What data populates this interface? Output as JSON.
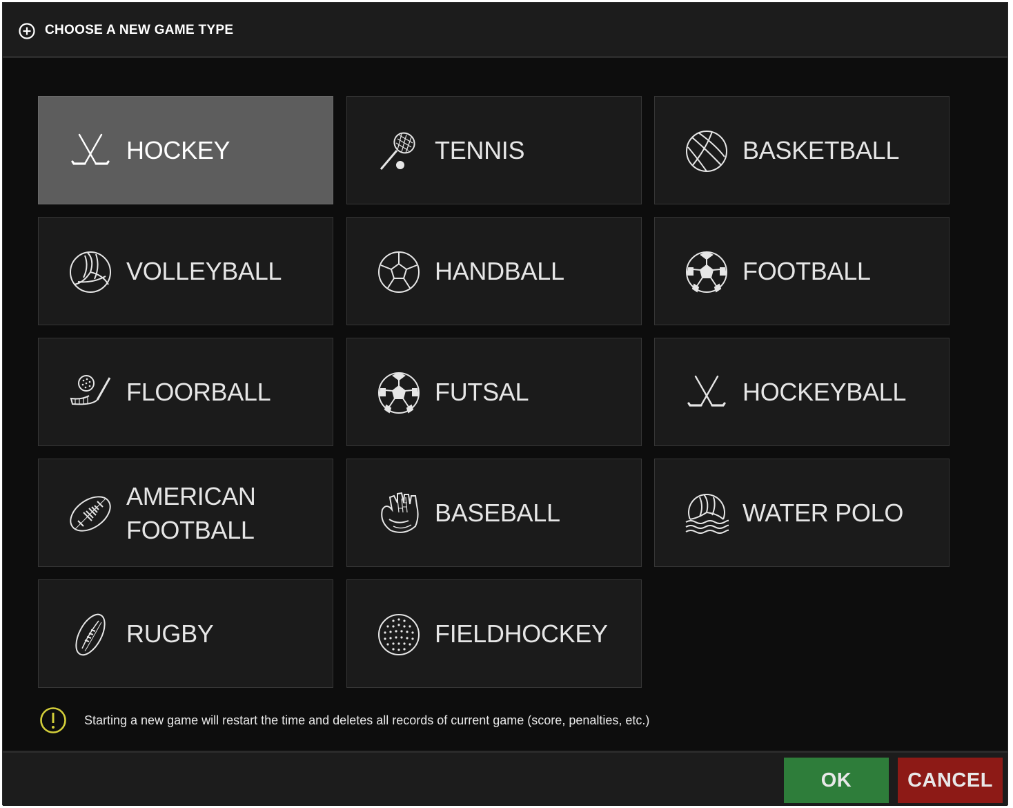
{
  "dialog": {
    "title": "CHOOSE A NEW GAME TYPE",
    "title_icon": "plus-circle-icon"
  },
  "game_types": [
    {
      "label": "HOCKEY",
      "icon": "hockey-sticks-icon",
      "selected": true
    },
    {
      "label": "TENNIS",
      "icon": "tennis-racket-icon",
      "selected": false
    },
    {
      "label": "BASKETBALL",
      "icon": "basketball-icon",
      "selected": false
    },
    {
      "label": "VOLLEYBALL",
      "icon": "volleyball-icon",
      "selected": false
    },
    {
      "label": "HANDBALL",
      "icon": "handball-icon",
      "selected": false
    },
    {
      "label": "FOOTBALL",
      "icon": "soccer-ball-icon",
      "selected": false
    },
    {
      "label": "FLOORBALL",
      "icon": "floorball-stick-icon",
      "selected": false
    },
    {
      "label": "FUTSAL",
      "icon": "futsal-ball-icon",
      "selected": false
    },
    {
      "label": "HOCKEYBALL",
      "icon": "hockey-sticks-icon",
      "selected": false
    },
    {
      "label": "AMERICAN\nFOOTBALL",
      "icon": "american-football-icon",
      "selected": false
    },
    {
      "label": "BASEBALL",
      "icon": "baseball-glove-icon",
      "selected": false
    },
    {
      "label": "WATER POLO",
      "icon": "water-polo-icon",
      "selected": false
    },
    {
      "label": "RUGBY",
      "icon": "rugby-ball-icon",
      "selected": false
    },
    {
      "label": "FIELDHOCKEY",
      "icon": "fieldhockey-ball-icon",
      "selected": false
    }
  ],
  "notice": {
    "icon": "warning-circle-icon",
    "text": "Starting a new game will restart the time and deletes all records of current game (score, penalties, etc.)"
  },
  "buttons": {
    "ok_label": "OK",
    "cancel_label": "CANCEL"
  },
  "colors": {
    "selected_tile": "#5d5d5d",
    "tile": "#1b1b1b",
    "ok": "#2e7d3a",
    "cancel": "#8d1a16",
    "warning": "#d4cf3a"
  }
}
